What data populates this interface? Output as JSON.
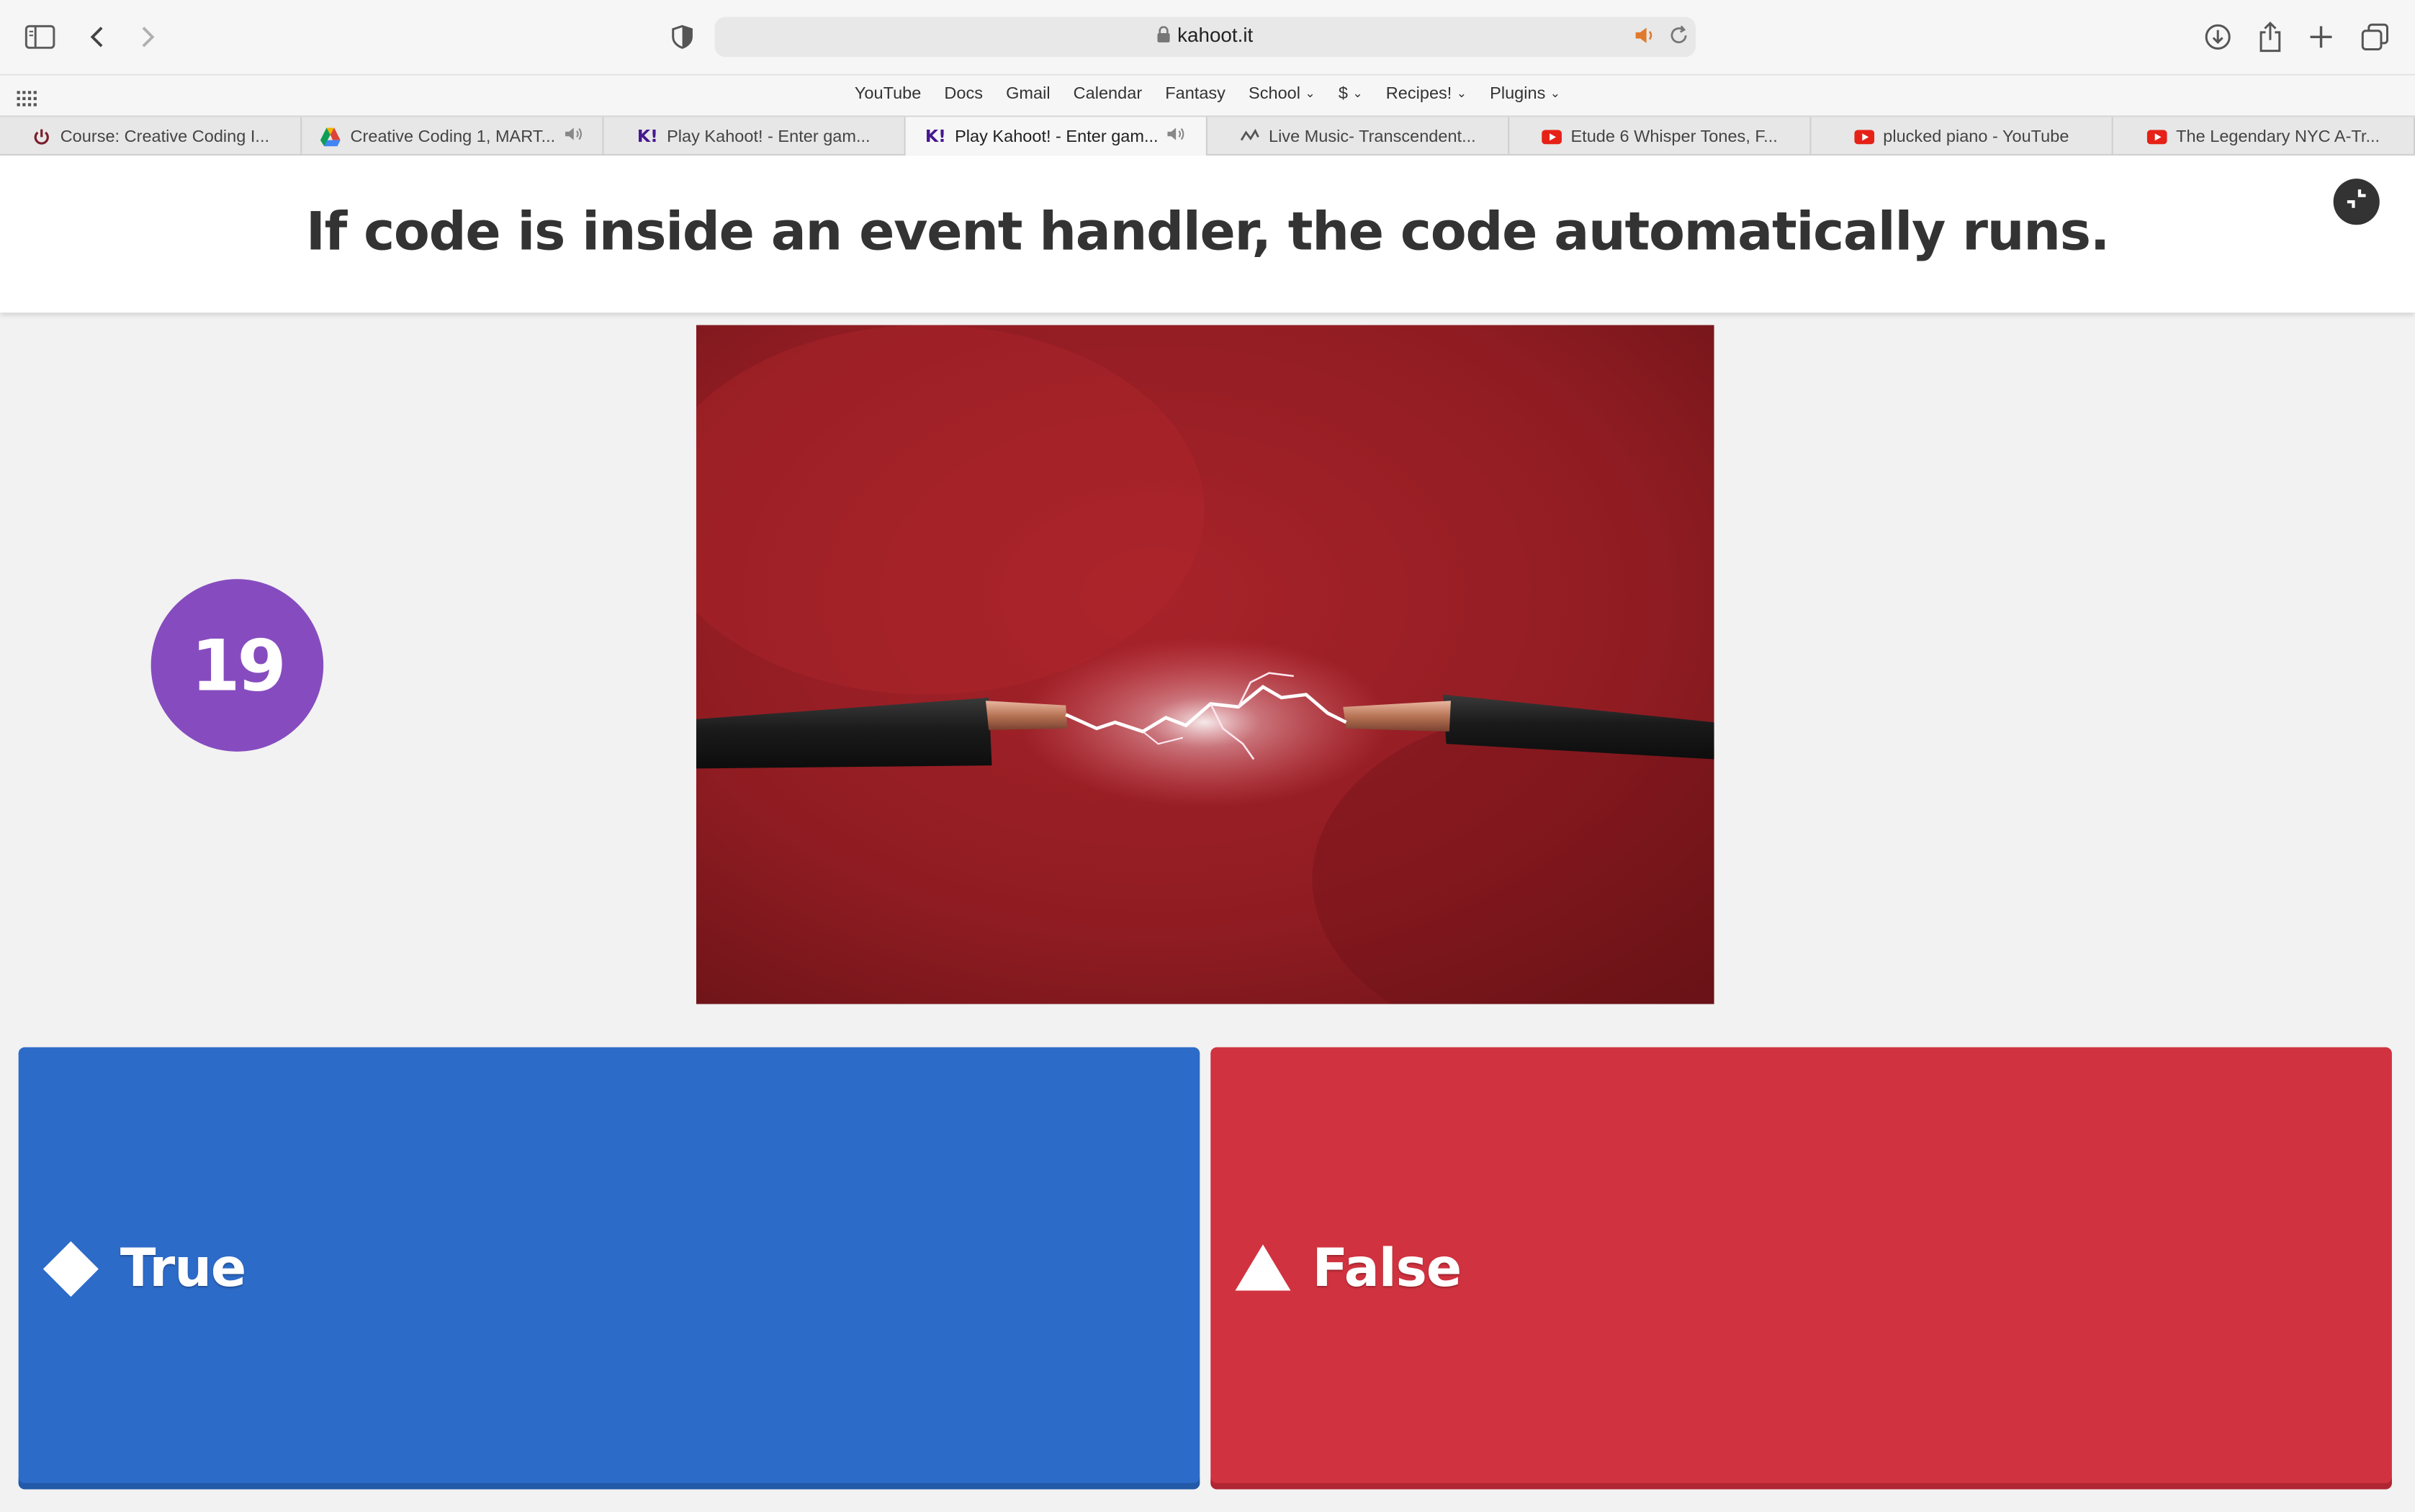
{
  "browser": {
    "url": "kahoot.it",
    "bookmarks": [
      {
        "label": "YouTube",
        "menu": false
      },
      {
        "label": "Docs",
        "menu": false
      },
      {
        "label": "Gmail",
        "menu": false
      },
      {
        "label": "Calendar",
        "menu": false
      },
      {
        "label": "Fantasy",
        "menu": false
      },
      {
        "label": "School",
        "menu": true
      },
      {
        "label": "$",
        "menu": true
      },
      {
        "label": "Recipes!",
        "menu": true
      },
      {
        "label": "Plugins",
        "menu": true
      }
    ],
    "tabs": [
      {
        "label": "Course: Creative Coding I...",
        "favicon": "power-icon",
        "audio": false,
        "active": false
      },
      {
        "label": "Creative Coding 1, MART...",
        "favicon": "drive-icon",
        "audio": true,
        "active": false
      },
      {
        "label": "Play Kahoot! - Enter gam...",
        "favicon": "kahoot-icon",
        "audio": false,
        "active": false
      },
      {
        "label": "Play Kahoot! - Enter gam...",
        "favicon": "kahoot-icon",
        "audio": true,
        "active": true
      },
      {
        "label": "Live Music- Transcendent...",
        "favicon": "music-icon",
        "audio": false,
        "active": false
      },
      {
        "label": "Etude 6 Whisper Tones, F...",
        "favicon": "youtube-icon",
        "audio": false,
        "active": false
      },
      {
        "label": "plucked piano - YouTube",
        "favicon": "youtube-icon",
        "audio": false,
        "active": false
      },
      {
        "label": "The Legendary NYC A-Tr...",
        "favicon": "youtube-icon",
        "audio": false,
        "active": false
      }
    ]
  },
  "kahoot": {
    "question": "If code is inside an event handler, the code automatically runs.",
    "timer": "19",
    "answers": [
      {
        "label": "True",
        "shape": "diamond-icon",
        "color": "#2d6bc8"
      },
      {
        "label": "False",
        "shape": "triangle-icon",
        "color": "#d1323f"
      }
    ]
  },
  "colors": {
    "timer": "#864cbf",
    "page_bg": "#f2f2f2"
  }
}
